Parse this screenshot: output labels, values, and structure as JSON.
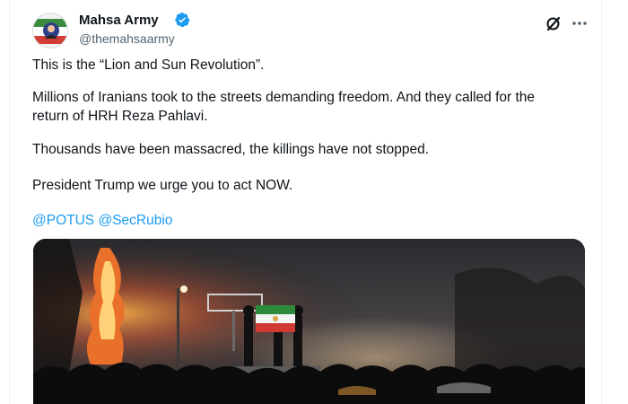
{
  "post": {
    "author": {
      "display_name": "Mahsa Army",
      "handle": "@themahsaarmy",
      "verified": true,
      "avatar_icon": "avatar-image"
    },
    "text": {
      "p1": "This is the “Lion and Sun Revolution”.",
      "p2": "Millions of Iranians took to the streets demanding freedom. And they called for the return of HRH Reza Pahlavi.",
      "p3": "Thousands have been massacred, the killings have not stopped.",
      "p4": "President Trump we urge you to act NOW."
    },
    "mentions": [
      "@POTUS",
      "@SecRubio"
    ],
    "media": {
      "type": "photo"
    }
  },
  "icons": {
    "verified": "verified-badge-icon",
    "grok": "x-logo-icon",
    "more": "more-options-icon"
  },
  "colors": {
    "link": "#1d9bf0",
    "verified": "#1d9bf0",
    "text": "#0f1419",
    "secondary": "#536471"
  }
}
